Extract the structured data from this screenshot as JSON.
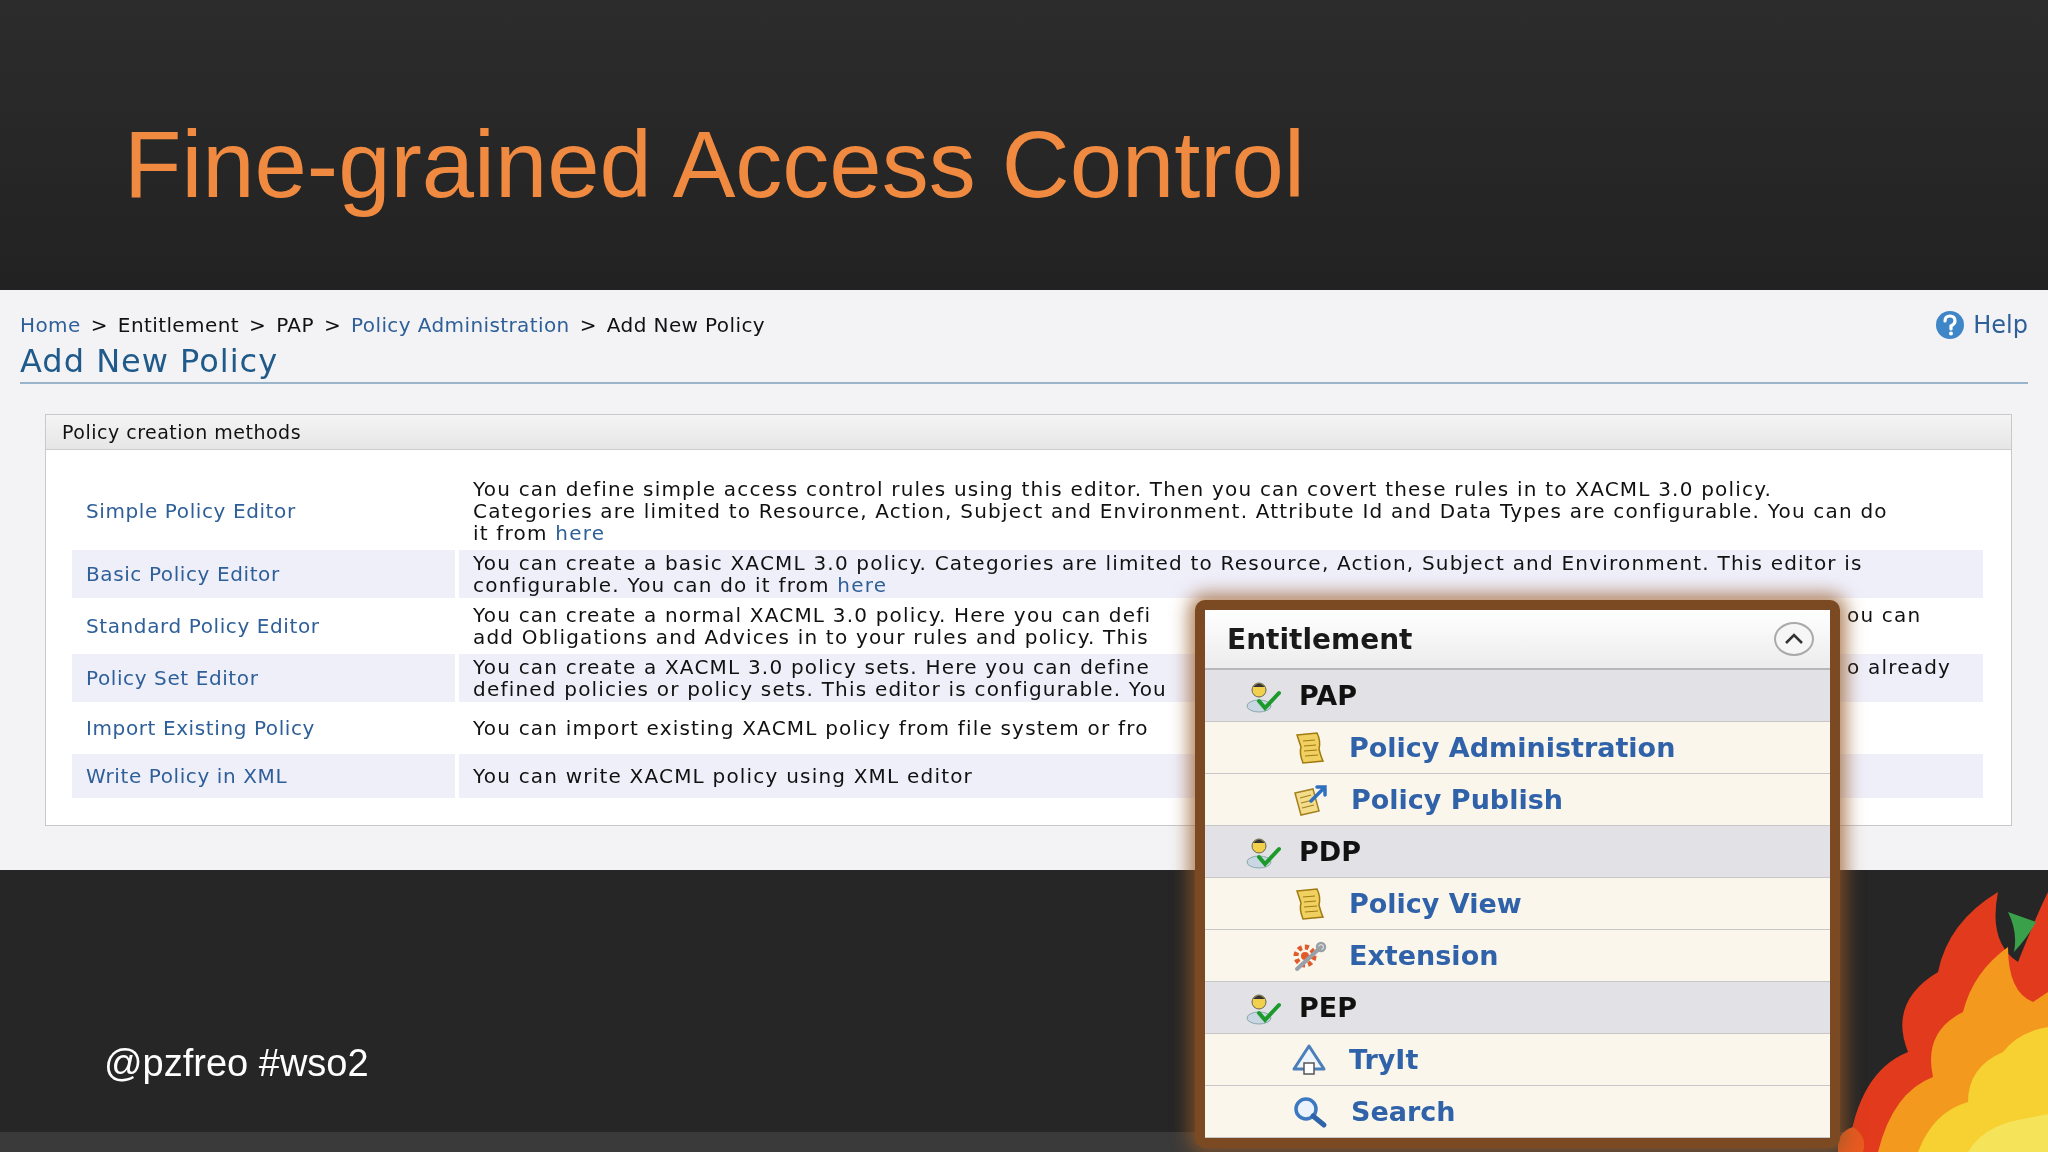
{
  "slide": {
    "title": "Fine-grained Access Control",
    "footer": "@pzfreo #wso2"
  },
  "breadcrumb": {
    "separator": ">",
    "items": [
      {
        "label": "Home",
        "kind": "link"
      },
      {
        "label": "Entitlement",
        "kind": "text"
      },
      {
        "label": "PAP",
        "kind": "text"
      },
      {
        "label": "Policy Administration",
        "kind": "link"
      },
      {
        "label": "Add New Policy",
        "kind": "text"
      }
    ]
  },
  "help": "Help",
  "page_title": "Add New Policy",
  "methods": {
    "title": "Policy creation methods",
    "rows": [
      {
        "label": "Simple Policy Editor",
        "lines": [
          {
            "segments": [
              {
                "kind": "text",
                "text": "You can define simple access control rules using this editor. Then you can covert these rules in to XACML 3.0 policy."
              }
            ]
          },
          {
            "segments": [
              {
                "kind": "text",
                "text": "Categories are limited to Resource, Action, Subject and Environment. Attribute Id and Data Types are configurable. You can do"
              }
            ]
          },
          {
            "segments": [
              {
                "kind": "text",
                "text": "it from "
              },
              {
                "kind": "link",
                "text": "here"
              }
            ]
          }
        ]
      },
      {
        "label": "Basic Policy Editor",
        "lines": [
          {
            "segments": [
              {
                "kind": "text",
                "text": "You can create a basic XACML 3.0 policy. Categories are limited to Resource, Action, Subject and Environment. This editor is"
              }
            ]
          },
          {
            "segments": [
              {
                "kind": "text",
                "text": "configurable. You can do it from "
              },
              {
                "kind": "link",
                "text": "here"
              }
            ]
          }
        ]
      },
      {
        "label": "Standard Policy Editor",
        "lines": [
          {
            "segments": [
              {
                "kind": "text",
                "text": "You can create a normal XACML 3.0 policy. Here you can defi"
              }
            ],
            "right": "ou can"
          },
          {
            "segments": [
              {
                "kind": "text",
                "text": "add Obligations and Advices in to your rules and policy. This"
              }
            ]
          }
        ]
      },
      {
        "label": "Policy Set Editor",
        "lines": [
          {
            "segments": [
              {
                "kind": "text",
                "text": "You can create a XACML 3.0 policy sets. Here you can define"
              }
            ],
            "right": "o already"
          },
          {
            "segments": [
              {
                "kind": "text",
                "text": "defined policies or policy sets. This editor is configurable. You"
              }
            ]
          }
        ]
      },
      {
        "label": "Import Existing Policy",
        "lines": [
          {
            "segments": [
              {
                "kind": "text",
                "text": "You can import existing XACML policy from file system or fro"
              }
            ]
          }
        ]
      },
      {
        "label": "Write Policy in XML",
        "lines": [
          {
            "segments": [
              {
                "kind": "text",
                "text": "You can write XACML policy using XML editor"
              }
            ]
          }
        ]
      }
    ]
  },
  "menu": {
    "title": "Entitlement",
    "expanded": true,
    "categories": [
      {
        "label": "PAP",
        "children": [
          {
            "label": "Policy Administration"
          },
          {
            "label": "Policy Publish"
          }
        ]
      },
      {
        "label": "PDP",
        "children": [
          {
            "label": "Policy View"
          },
          {
            "label": "Extension"
          }
        ]
      },
      {
        "label": "PEP",
        "children": [
          {
            "label": "TryIt"
          },
          {
            "label": "Search"
          }
        ]
      }
    ]
  }
}
